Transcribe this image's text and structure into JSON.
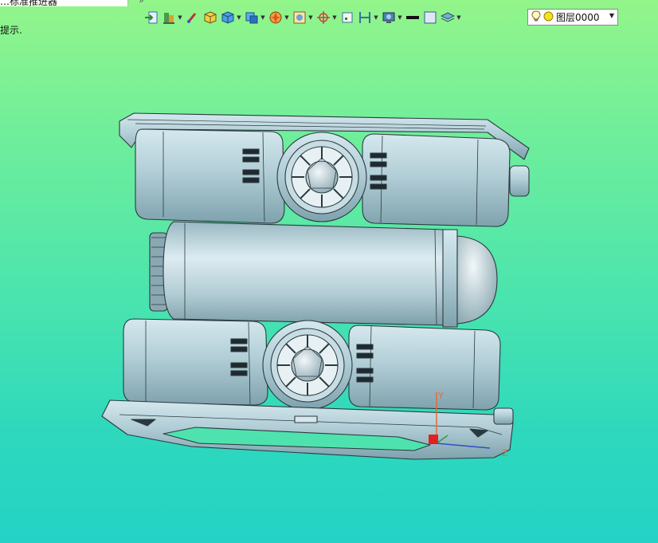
{
  "tab": {
    "title": "…标准推进器",
    "more": "»"
  },
  "hint": {
    "text": "提示."
  },
  "toolbar": {
    "icons": [
      "import-icon",
      "stack-icon",
      "brush-icon",
      "cube-yellow-icon",
      "cube-blue-icon",
      "view-cube-icon",
      "sphere-shade-icon",
      "wireframe-icon",
      "axis-icon",
      "frame-icon",
      "section-icon",
      "display-icon",
      "line-color-icon",
      "fill-icon",
      "layers-icon"
    ]
  },
  "layer": {
    "value": "图层0000",
    "icon_bulb": "bulb-icon",
    "icon_status": "status-dot-icon"
  },
  "colors": {
    "bg_top": "#93f58a",
    "bg_bottom": "#24d3c6",
    "model": "#a8c6cf",
    "edges": "#2b3a40"
  },
  "axes": {
    "x": "X",
    "y": "Y",
    "z": "Z"
  }
}
